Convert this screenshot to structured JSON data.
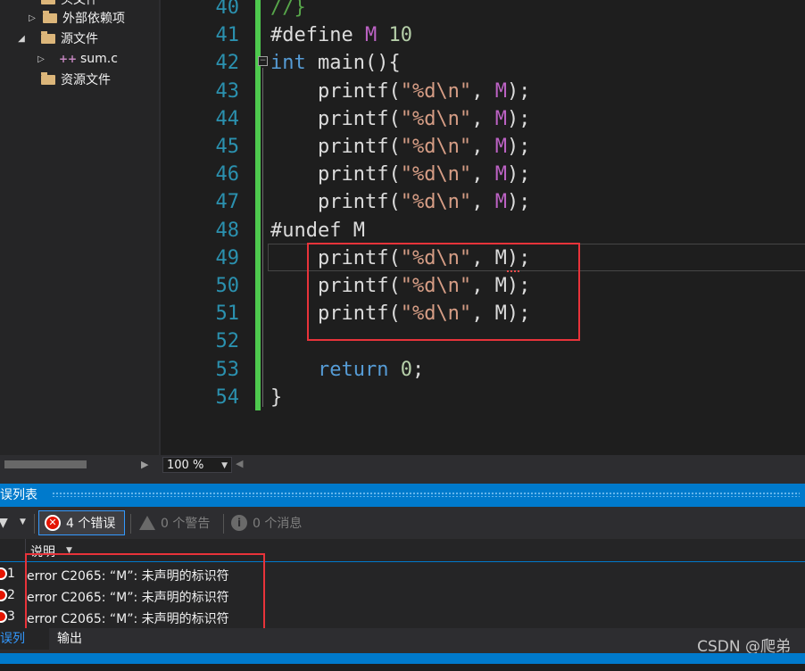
{
  "explorer": {
    "items": [
      {
        "label": "头文件",
        "kind": "folder",
        "expanded": false
      },
      {
        "label": "外部依赖项",
        "kind": "folder",
        "expanded": false
      },
      {
        "label": "源文件",
        "kind": "folder",
        "expanded": true
      },
      {
        "label": "sum.c",
        "kind": "c-file",
        "expanded": false
      },
      {
        "label": "资源文件",
        "kind": "folder",
        "expanded": false
      }
    ]
  },
  "editor": {
    "lines": [
      {
        "n": "40",
        "tokens": [
          {
            "t": "//}",
            "c": "cmt"
          }
        ]
      },
      {
        "n": "41",
        "tokens": [
          {
            "t": "#define ",
            "c": ""
          },
          {
            "t": "M",
            "c": "mac"
          },
          {
            "t": " ",
            "c": ""
          },
          {
            "t": "10",
            "c": "num"
          }
        ]
      },
      {
        "n": "42",
        "tokens": [
          {
            "t": "int",
            "c": "kw"
          },
          {
            "t": " main(){",
            "c": ""
          }
        ]
      },
      {
        "n": "43",
        "tokens": [
          {
            "t": "    printf(",
            "c": ""
          },
          {
            "t": "\"%d\\n\"",
            "c": "str"
          },
          {
            "t": ", ",
            "c": ""
          },
          {
            "t": "M",
            "c": "mac"
          },
          {
            "t": ");",
            "c": ""
          }
        ]
      },
      {
        "n": "44",
        "tokens": [
          {
            "t": "    printf(",
            "c": ""
          },
          {
            "t": "\"%d\\n\"",
            "c": "str"
          },
          {
            "t": ", ",
            "c": ""
          },
          {
            "t": "M",
            "c": "mac"
          },
          {
            "t": ");",
            "c": ""
          }
        ]
      },
      {
        "n": "45",
        "tokens": [
          {
            "t": "    printf(",
            "c": ""
          },
          {
            "t": "\"%d\\n\"",
            "c": "str"
          },
          {
            "t": ", ",
            "c": ""
          },
          {
            "t": "M",
            "c": "mac"
          },
          {
            "t": ");",
            "c": ""
          }
        ]
      },
      {
        "n": "46",
        "tokens": [
          {
            "t": "    printf(",
            "c": ""
          },
          {
            "t": "\"%d\\n\"",
            "c": "str"
          },
          {
            "t": ", ",
            "c": ""
          },
          {
            "t": "M",
            "c": "mac"
          },
          {
            "t": ");",
            "c": ""
          }
        ]
      },
      {
        "n": "47",
        "tokens": [
          {
            "t": "    printf(",
            "c": ""
          },
          {
            "t": "\"%d\\n\"",
            "c": "str"
          },
          {
            "t": ", ",
            "c": ""
          },
          {
            "t": "M",
            "c": "mac"
          },
          {
            "t": ");",
            "c": ""
          }
        ]
      },
      {
        "n": "48",
        "tokens": [
          {
            "t": "#undef M",
            "c": ""
          }
        ]
      },
      {
        "n": "49",
        "tokens": [
          {
            "t": "    printf(",
            "c": ""
          },
          {
            "t": "\"%d\\n\"",
            "c": "str"
          },
          {
            "t": ", M);",
            "c": ""
          }
        ]
      },
      {
        "n": "50",
        "tokens": [
          {
            "t": "    printf(",
            "c": ""
          },
          {
            "t": "\"%d\\n\"",
            "c": "str"
          },
          {
            "t": ", M);",
            "c": ""
          }
        ]
      },
      {
        "n": "51",
        "tokens": [
          {
            "t": "    printf(",
            "c": ""
          },
          {
            "t": "\"%d\\n\"",
            "c": "str"
          },
          {
            "t": ", M);",
            "c": ""
          }
        ]
      },
      {
        "n": "52",
        "tokens": []
      },
      {
        "n": "53",
        "tokens": [
          {
            "t": "    ",
            "c": ""
          },
          {
            "t": "return",
            "c": "kw"
          },
          {
            "t": " ",
            "c": ""
          },
          {
            "t": "0",
            "c": "num"
          },
          {
            "t": ";",
            "c": ""
          }
        ]
      },
      {
        "n": "54",
        "tokens": [
          {
            "t": "}",
            "c": ""
          }
        ]
      }
    ],
    "colors": {
      "keyword": "#569cd6",
      "string": "#d69d85",
      "macro": "#bd63c5",
      "number": "#b5cea8",
      "comment": "#57a64a",
      "line_number": "#2b91af"
    }
  },
  "zoom": {
    "value": "100 %"
  },
  "error_panel": {
    "title": "错误列表",
    "errors_label": "4 个错误",
    "warnings_label": "0 个警告",
    "messages_label": "0 个消息",
    "column_header": "说明",
    "rows": [
      {
        "num": "1",
        "desc": "error C2065: “M”: 未声明的标识符"
      },
      {
        "num": "2",
        "desc": "error C2065: “M”: 未声明的标识符"
      },
      {
        "num": "3",
        "desc": "error C2065: “M”: 未声明的标识符"
      }
    ],
    "tabs": [
      {
        "label": "错误列表",
        "active": true
      },
      {
        "label": "输出",
        "active": false
      }
    ]
  },
  "watermark": "CSDN @爬弟",
  "accent_color": "#007acc"
}
